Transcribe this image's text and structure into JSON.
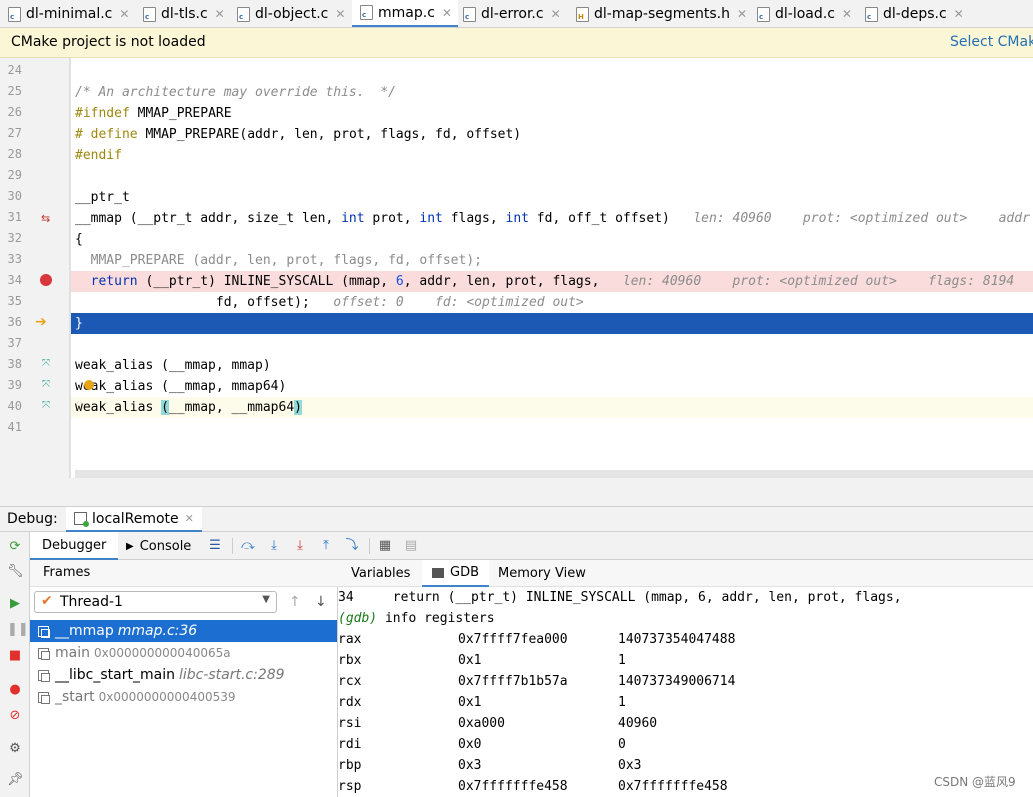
{
  "tabs": [
    {
      "label": "dl-minimal.c",
      "type": "c"
    },
    {
      "label": "dl-tls.c",
      "type": "c"
    },
    {
      "label": "dl-object.c",
      "type": "c"
    },
    {
      "label": "mmap.c",
      "type": "c",
      "active": true
    },
    {
      "label": "dl-error.c",
      "type": "c"
    },
    {
      "label": "dl-map-segments.h",
      "type": "h"
    },
    {
      "label": "dl-load.c",
      "type": "c"
    },
    {
      "label": "dl-deps.c",
      "type": "c"
    }
  ],
  "cmake": {
    "message": "CMake project is not loaded",
    "action": "Select CMak"
  },
  "editor": {
    "line_numbers": [
      "24",
      "25",
      "26",
      "27",
      "28",
      "29",
      "30",
      "31",
      "32",
      "33",
      "34",
      "35",
      "36",
      "37",
      "38",
      "39",
      "40",
      "41"
    ],
    "code": {
      "l25": "/* An architecture may override this.  */",
      "l26_pp": "#ifndef",
      "l26_rest": " MMAP_PREPARE",
      "l27_pp": "# define",
      "l27_rest": " MMAP_PREPARE(addr, len, prot, flags, fd, offset)",
      "l28_pp": "#endif",
      "l30": "__ptr_t",
      "l31_a": "__mmap (__ptr_t addr, size_t len, ",
      "l31_kw1": "int",
      "l31_b": " prot, ",
      "l31_kw2": "int",
      "l31_c": " flags, ",
      "l31_kw3": "int",
      "l31_d": " fd, off_t offset)",
      "l31_hint": "   len: 40960    prot: <optimized out>    addr",
      "l32": "{",
      "l33": "  MMAP_PREPARE (addr, len, prot, flags, fd, offset);",
      "l34_kw": "  return",
      "l34_a": " (__ptr_t) INLINE_SYSCALL (mmap, ",
      "l34_num": "6",
      "l34_b": ", addr, len, prot, flags,",
      "l34_hint": "   len: 40960    prot: <optimized out>    flags: 8194",
      "l35": "                  fd, offset);",
      "l35_hint": "   offset: 0    fd: <optimized out>",
      "l36": "}",
      "l38": "weak_alias (__mmap, mmap)",
      "l39": "weak_alias (__mmap, mmap64)",
      "l40_a": "weak_alias ",
      "l40_p1": "(",
      "l40_b": "__mmap, __mmap64",
      "l40_p2": ")"
    }
  },
  "debug": {
    "label": "Debug:",
    "run_config": "localRemote",
    "tabs": [
      "Debugger",
      "Console"
    ],
    "frames_header": "Frames",
    "thread": "Thread-1",
    "frames": [
      {
        "fn": "__mmap",
        "loc": "mmap.c:36",
        "selected": true
      },
      {
        "fn": "main",
        "addr": "0x000000000040065a"
      },
      {
        "fn": "__libc_start_main",
        "loc": "libc-start.c:289"
      },
      {
        "fn": "_start",
        "addr": "0x0000000000400539"
      }
    ],
    "right_tabs": [
      "Variables",
      "GDB",
      "Memory View"
    ],
    "gdb": {
      "line1": "34     return (__ptr_t) INLINE_SYSCALL (mmap, 6, addr, len, prot, flags,",
      "prompt": "(gdb)",
      "cmd": " info registers",
      "registers": [
        {
          "name": "rax",
          "hex": "0x7ffff7fea000",
          "val": "140737354047488"
        },
        {
          "name": "rbx",
          "hex": "0x1",
          "val": "1"
        },
        {
          "name": "rcx",
          "hex": "0x7ffff7b1b57a",
          "val": "140737349006714"
        },
        {
          "name": "rdx",
          "hex": "0x1",
          "val": "1"
        },
        {
          "name": "rsi",
          "hex": "0xa000",
          "val": "40960"
        },
        {
          "name": "rdi",
          "hex": "0x0",
          "val": "0"
        },
        {
          "name": "rbp",
          "hex": "0x3",
          "val": "0x3"
        },
        {
          "name": "rsp",
          "hex": "0x7fffffffe458",
          "val": "0x7fffffffe458"
        }
      ]
    }
  },
  "watermark": "CSDN @蓝风9"
}
